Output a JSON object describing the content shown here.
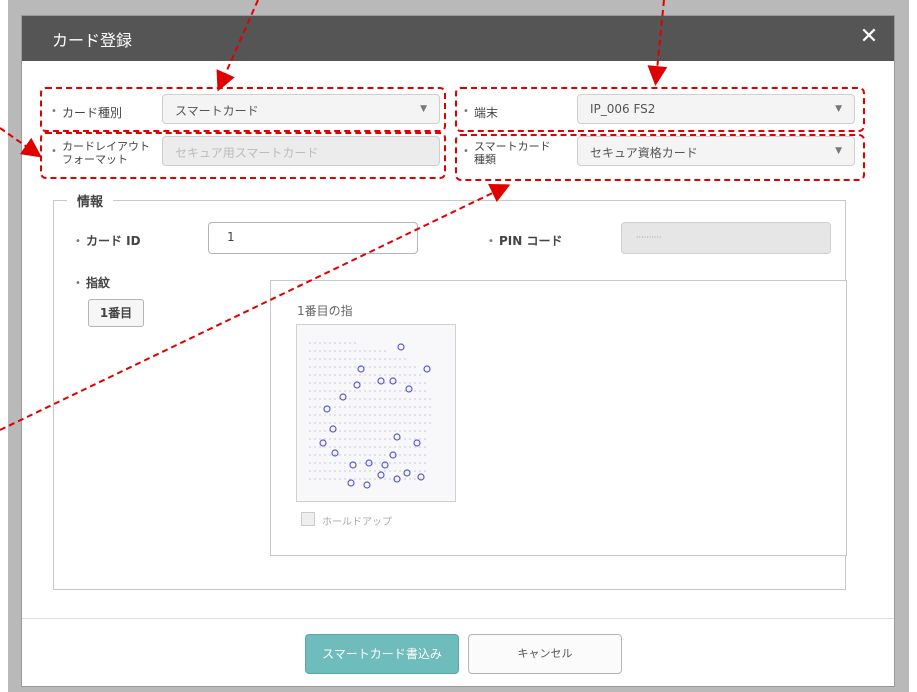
{
  "dialog": {
    "title": "カード登録",
    "close_symbol": "✕"
  },
  "fields": {
    "card_type": {
      "label": "カード種別",
      "value": "スマートカード"
    },
    "terminal": {
      "label": "端末",
      "value": "IP_006 FS2"
    },
    "layout_format": {
      "label_line1": "カードレイアウト",
      "label_line2": "フォーマット",
      "value": "セキュア用スマートカード"
    },
    "smartcard_type": {
      "label_line1": "スマートカード",
      "label_line2": "種類",
      "value": "セキュア資格カード"
    }
  },
  "info": {
    "group_title": "情報",
    "card_id_label": "カード ID",
    "card_id_value": "1",
    "pin_label": "PIN コード",
    "pin_value": "··········",
    "fingerprint_label": "指紋",
    "finger_button": "1番目",
    "panel_title": "1番目の指",
    "holdup_label": "ホールドアップ"
  },
  "buttons": {
    "write": "スマートカード書込み",
    "cancel": "キャンセル"
  },
  "colors": {
    "titlebar": "#555555",
    "highlight": "#e00000",
    "primary": "#6fbcbc"
  }
}
